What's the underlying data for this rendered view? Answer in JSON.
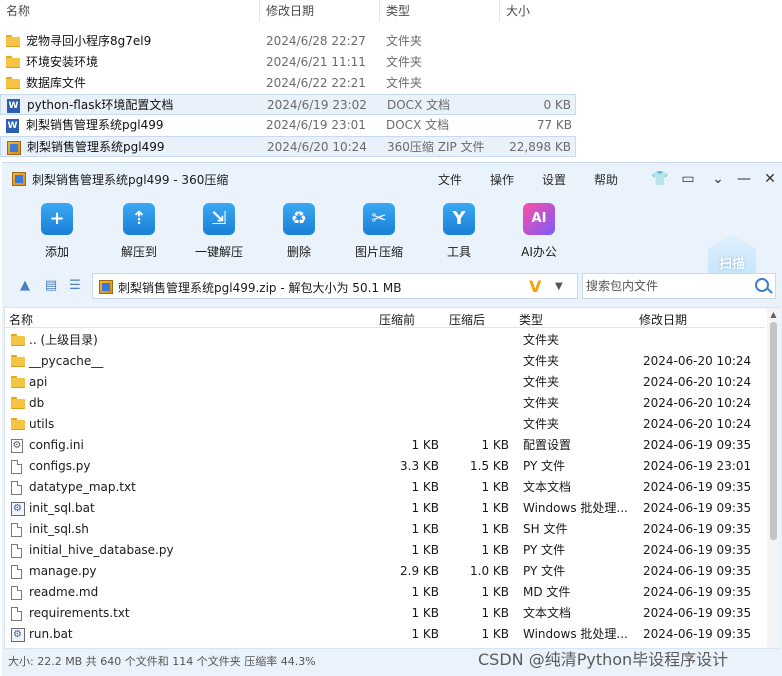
{
  "explorer": {
    "columns": [
      "名称",
      "修改日期",
      "类型",
      "大小"
    ],
    "rows": [
      {
        "name": "宠物寻回小程序8g7el9",
        "date": "2024/6/28 22:27",
        "type": "文件夹",
        "size": "",
        "icon": "folder-icon"
      },
      {
        "name": "环境安装环境",
        "date": "2024/6/21 11:11",
        "type": "文件夹",
        "size": "",
        "icon": "folder-icon"
      },
      {
        "name": "数据库文件",
        "date": "2024/6/22 22:21",
        "type": "文件夹",
        "size": "",
        "icon": "folder-icon"
      },
      {
        "name": "python-flask环境配置文档",
        "date": "2024/6/19 23:02",
        "type": "DOCX 文档",
        "size": "0 KB",
        "icon": "docx-icon"
      },
      {
        "name": "刺梨销售管理系统pgl499",
        "date": "2024/6/19 23:01",
        "type": "DOCX 文档",
        "size": "77 KB",
        "icon": "docx-icon"
      },
      {
        "name": "刺梨销售管理系统pgl499",
        "date": "2024/6/20 10:24",
        "type": "360压缩 ZIP 文件",
        "size": "22,898 KB",
        "icon": "zip-icon"
      }
    ]
  },
  "zip": {
    "title": "刺梨销售管理系统pgl499 - 360压缩",
    "menu": [
      "文件",
      "操作",
      "设置",
      "帮助"
    ],
    "toolbar": [
      {
        "label": "添加",
        "icon": "add-icon",
        "glyph": "+"
      },
      {
        "label": "解压到",
        "icon": "extract-to-icon",
        "glyph": "⇡"
      },
      {
        "label": "一键解压",
        "icon": "one-click-extract-icon",
        "glyph": "⇲"
      },
      {
        "label": "删除",
        "icon": "delete-icon",
        "glyph": "♻"
      },
      {
        "label": "图片压缩",
        "icon": "image-compress-icon",
        "glyph": "✂"
      },
      {
        "label": "工具",
        "icon": "tools-icon",
        "glyph": "Y"
      },
      {
        "label": "AI办公",
        "icon": "ai-office-icon",
        "glyph": "AI"
      }
    ],
    "scan_label": "扫描",
    "path_text": "刺梨销售管理系统pgl499.zip - 解包大小为 50.1 MB",
    "vip_badge": "V",
    "search_placeholder": "搜索包内文件",
    "list_headers": {
      "name": "名称",
      "before": "压缩前",
      "after": "压缩后",
      "type": "类型",
      "mtime": "修改日期"
    },
    "files": [
      {
        "name": ".. (上级目录)",
        "before": "",
        "after": "",
        "type": "文件夹",
        "mtime": "",
        "icon": "folder-icon"
      },
      {
        "name": "__pycache__",
        "before": "",
        "after": "",
        "type": "文件夹",
        "mtime": "2024-06-20 10:24",
        "icon": "folder-icon"
      },
      {
        "name": "api",
        "before": "",
        "after": "",
        "type": "文件夹",
        "mtime": "2024-06-20 10:24",
        "icon": "folder-icon"
      },
      {
        "name": "db",
        "before": "",
        "after": "",
        "type": "文件夹",
        "mtime": "2024-06-20 10:24",
        "icon": "folder-icon"
      },
      {
        "name": "utils",
        "before": "",
        "after": "",
        "type": "文件夹",
        "mtime": "2024-06-20 10:24",
        "icon": "folder-icon"
      },
      {
        "name": "config.ini",
        "before": "1 KB",
        "after": "1 KB",
        "type": "配置设置",
        "mtime": "2024-06-19 09:35",
        "icon": "settings-file-icon"
      },
      {
        "name": "configs.py",
        "before": "3.3 KB",
        "after": "1.5 KB",
        "type": "PY 文件",
        "mtime": "2024-06-19 23:01",
        "icon": "file-icon"
      },
      {
        "name": "datatype_map.txt",
        "before": "1 KB",
        "after": "1 KB",
        "type": "文本文档",
        "mtime": "2024-06-19 09:35",
        "icon": "file-icon"
      },
      {
        "name": "init_sql.bat",
        "before": "1 KB",
        "after": "1 KB",
        "type": "Windows 批处理...",
        "mtime": "2024-06-19 09:35",
        "icon": "bat-icon"
      },
      {
        "name": "init_sql.sh",
        "before": "1 KB",
        "after": "1 KB",
        "type": "SH 文件",
        "mtime": "2024-06-19 09:35",
        "icon": "file-icon"
      },
      {
        "name": "initial_hive_database.py",
        "before": "1 KB",
        "after": "1 KB",
        "type": "PY 文件",
        "mtime": "2024-06-19 09:35",
        "icon": "file-icon"
      },
      {
        "name": "manage.py",
        "before": "2.9 KB",
        "after": "1.0 KB",
        "type": "PY 文件",
        "mtime": "2024-06-19 09:35",
        "icon": "file-icon"
      },
      {
        "name": "readme.md",
        "before": "1 KB",
        "after": "1 KB",
        "type": "MD 文件",
        "mtime": "2024-06-19 09:35",
        "icon": "file-icon"
      },
      {
        "name": "requirements.txt",
        "before": "1 KB",
        "after": "1 KB",
        "type": "文本文档",
        "mtime": "2024-06-19 09:35",
        "icon": "file-icon"
      },
      {
        "name": "run.bat",
        "before": "1 KB",
        "after": "1 KB",
        "type": "Windows 批处理...",
        "mtime": "2024-06-19 09:35",
        "icon": "bat-icon"
      }
    ],
    "status": "大小: 22.2 MB 共 640 个文件和 114 个文件夹 压缩率 44.3%"
  },
  "watermark": "CSDN @纯清Python毕设程序设计",
  "colors": {
    "accent": "#1a7fd8",
    "window_bg": "#eaf3fc",
    "selection": "#e9f1fb"
  }
}
